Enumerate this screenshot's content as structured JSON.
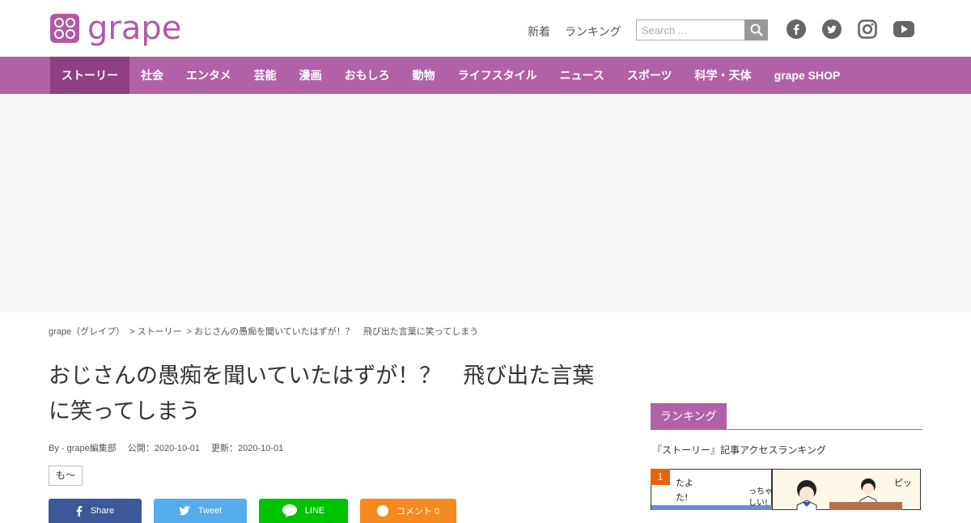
{
  "header": {
    "logo_text": "grape",
    "links": [
      "新着",
      "ランキング"
    ],
    "search_placeholder": "Search ...",
    "social_icons": [
      "facebook-icon",
      "twitter-icon",
      "instagram-icon",
      "youtube-icon"
    ]
  },
  "nav": {
    "items": [
      "ストーリー",
      "社会",
      "エンタメ",
      "芸能",
      "漫画",
      "おもしろ",
      "動物",
      "ライフスタイル",
      "ニュース",
      "スポーツ",
      "科学・天体",
      "grape SHOP"
    ],
    "active_index": 0
  },
  "breadcrumb": [
    "grape（グレイプ）",
    "> ストーリー",
    "> おじさんの愚痴を聞いていたはずが！？　飛び出た言葉に笑ってしまう"
  ],
  "article": {
    "title": "おじさんの愚痴を聞いていたはずが！？　飛び出た言葉に笑ってしまう",
    "author": "By - grape編集部",
    "published": "公開：2020-10-01",
    "updated": "更新：2020-10-01",
    "tag": "も～"
  },
  "share": {
    "facebook": "Share",
    "twitter": "Tweet",
    "line": "LINE",
    "comment": "コメント 0"
  },
  "sidebar": {
    "heading": "ランキング",
    "subheading": "『ストーリー』記事アクセスランキング",
    "rank_number": "1"
  },
  "colors": {
    "brand": "#b161a8",
    "nav_active": "#8e3f86",
    "rank_badge": "#e8620c"
  }
}
